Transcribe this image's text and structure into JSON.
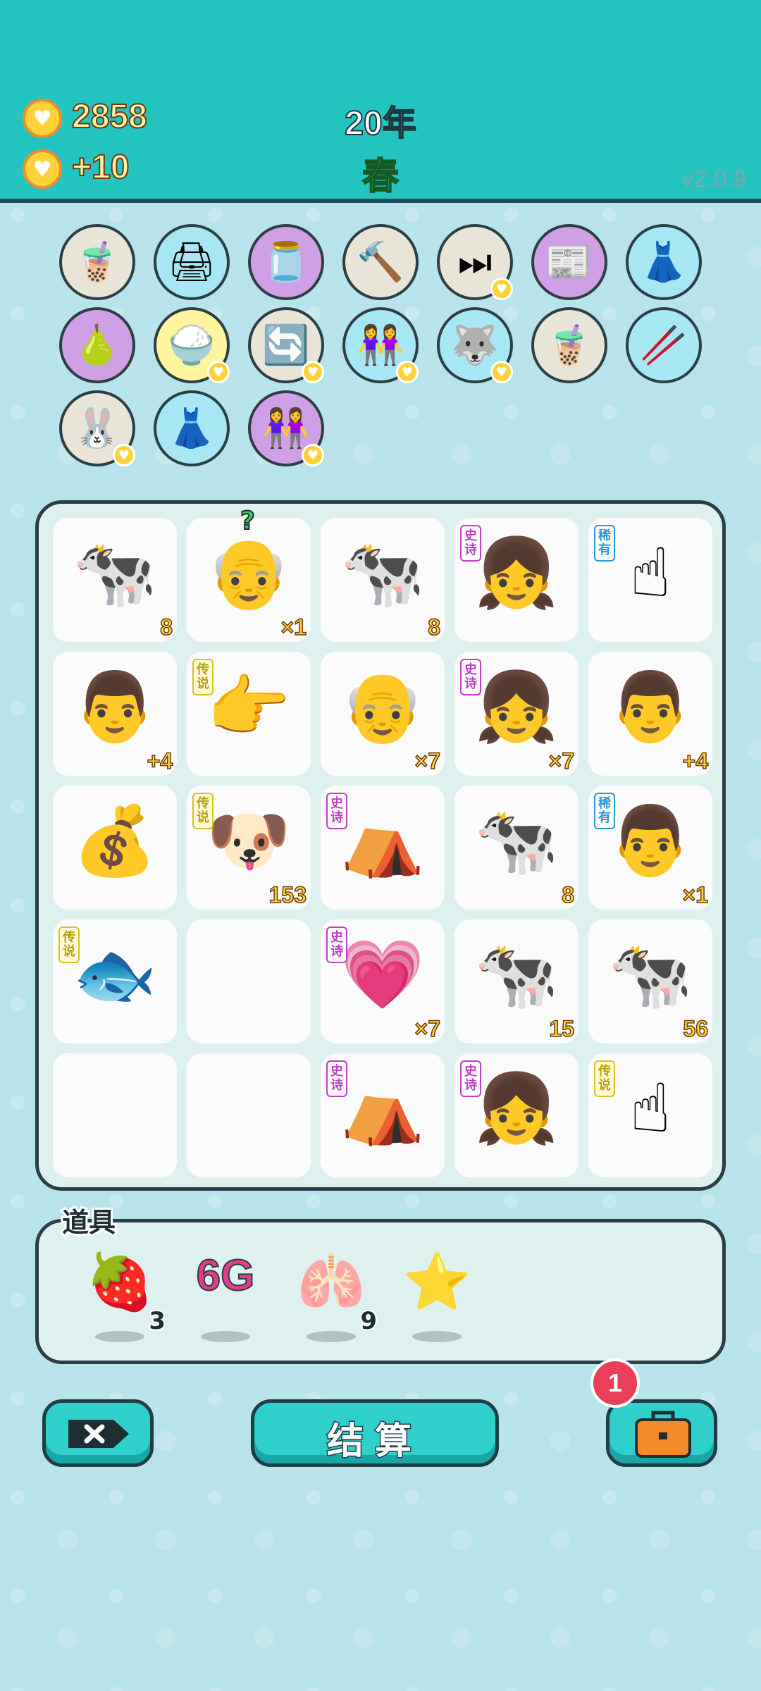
{
  "header": {
    "coins": "2858",
    "income": "+10",
    "year": "20年",
    "season": "春",
    "version": "v2.0.9"
  },
  "items": [
    {
      "name": "bubble-tea-icon",
      "color": "#e9e4d8",
      "heart": false
    },
    {
      "name": "printer-icon",
      "color": "#a7e6f3",
      "heart": false
    },
    {
      "name": "milk-jar-icon",
      "color": "#cfa0e6",
      "heart": false
    },
    {
      "name": "hammer-icon",
      "color": "#e9e4d8",
      "heart": false
    },
    {
      "name": "skip-icon",
      "color": "#e9e4d8",
      "heart": true
    },
    {
      "name": "time-magazine-icon",
      "color": "#cfa0e6",
      "heart": false
    },
    {
      "name": "skirt-icon",
      "color": "#a7e6f3",
      "heart": false
    },
    {
      "name": "grapefruit-icon",
      "color": "#cfa0e6",
      "heart": false
    },
    {
      "name": "rice-bowl-icon",
      "color": "#fff59e",
      "heart": true
    },
    {
      "name": "refresh-icon",
      "color": "#e9e4d8",
      "heart": true
    },
    {
      "name": "twins-icon",
      "color": "#a7e6f3",
      "heart": true
    },
    {
      "name": "husky-icon",
      "color": "#a7e6f3",
      "heart": true
    },
    {
      "name": "bubble-tea-2-icon",
      "color": "#e9e4d8",
      "heart": false
    },
    {
      "name": "chopsticks-icon",
      "color": "#a7e6f3",
      "heart": false
    },
    {
      "name": "rabbit-icon",
      "color": "#e9e4d8",
      "heart": true
    },
    {
      "name": "skirt-2-icon",
      "color": "#a7e6f3",
      "heart": false
    },
    {
      "name": "twins-2-icon",
      "color": "#cfa0e6",
      "heart": true
    }
  ],
  "tags": {
    "epic": "史诗",
    "rare": "稀有",
    "legend": "传说"
  },
  "board": [
    {
      "name": "cow-icon",
      "tag": "",
      "count": "8"
    },
    {
      "name": "old-man-icon",
      "tag": "",
      "count": "×1",
      "mark": "?"
    },
    {
      "name": "cow-icon",
      "tag": "",
      "count": "8"
    },
    {
      "name": "girl-braids-icon",
      "tag": "epic",
      "count": ""
    },
    {
      "name": "pointing-finger-icon",
      "tag": "rare",
      "count": ""
    },
    {
      "name": "man-icon",
      "tag": "",
      "count": "+4"
    },
    {
      "name": "yellow-pointing-hand-icon",
      "tag": "legend",
      "count": ""
    },
    {
      "name": "old-man-icon",
      "tag": "",
      "count": "×7"
    },
    {
      "name": "girl-braids-icon",
      "tag": "epic",
      "count": "×7"
    },
    {
      "name": "man-icon",
      "tag": "",
      "count": "+4"
    },
    {
      "name": "coin-pile-icon",
      "tag": "",
      "count": ""
    },
    {
      "name": "husky-king-icon",
      "tag": "legend",
      "count": "153"
    },
    {
      "name": "rabbit-house-icon",
      "tag": "epic",
      "count": ""
    },
    {
      "name": "cow-icon",
      "tag": "",
      "count": "8"
    },
    {
      "name": "bald-man-icon",
      "tag": "rare",
      "count": "×1"
    },
    {
      "name": "koi-fish-icon",
      "tag": "legend",
      "count": ""
    },
    {
      "name": "empty",
      "tag": "",
      "count": ""
    },
    {
      "name": "girl-heart-icon",
      "tag": "epic",
      "count": "×7"
    },
    {
      "name": "cow-icon",
      "tag": "",
      "count": "15"
    },
    {
      "name": "cow-icon",
      "tag": "",
      "count": "56"
    },
    {
      "name": "empty",
      "tag": "",
      "count": ""
    },
    {
      "name": "empty",
      "tag": "",
      "count": ""
    },
    {
      "name": "rabbit-house-icon",
      "tag": "epic",
      "count": ""
    },
    {
      "name": "girl-braids-icon",
      "tag": "epic",
      "count": ""
    },
    {
      "name": "raised-hand-icon",
      "tag": "legend",
      "count": ""
    }
  ],
  "props": {
    "title": "道具",
    "list": [
      {
        "name": "lychee-icon",
        "count": "3"
      },
      {
        "name": "6g-icon",
        "label": "6G",
        "count": ""
      },
      {
        "name": "liver-icon",
        "count": "9"
      },
      {
        "name": "star-icon",
        "count": ""
      }
    ]
  },
  "buttons": {
    "settle": "结算",
    "badge": "1"
  }
}
